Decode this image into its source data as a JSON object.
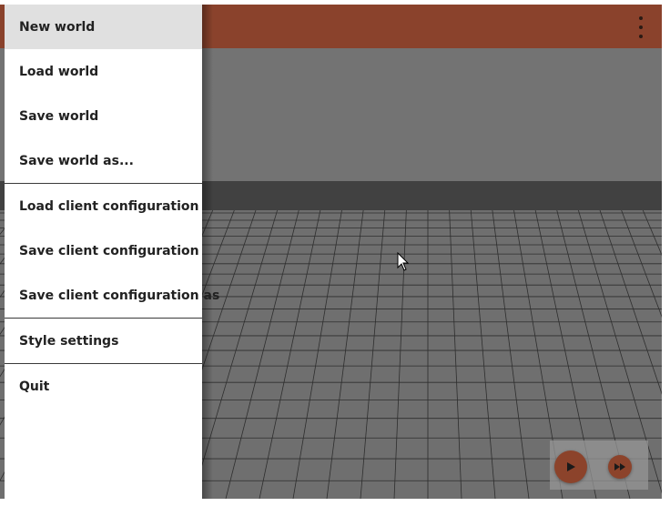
{
  "menu": {
    "groups": [
      {
        "items": [
          {
            "label": "New world",
            "active": true
          },
          {
            "label": "Load world"
          },
          {
            "label": "Save world"
          },
          {
            "label": "Save world as..."
          }
        ]
      },
      {
        "items": [
          {
            "label": "Load client configuration"
          },
          {
            "label": "Save client configuration"
          },
          {
            "label": "Save client configuration as"
          }
        ]
      },
      {
        "items": [
          {
            "label": "Style settings"
          }
        ]
      },
      {
        "items": [
          {
            "label": "Quit"
          }
        ]
      }
    ]
  },
  "toolbar": {
    "menu_icon": "more-vert-icon",
    "color": "#8a422c"
  },
  "simulation": {
    "play_icon": "play-icon",
    "fast_forward_icon": "fast-forward-icon",
    "button_color": "#8c432b"
  },
  "colors": {
    "accent": "#8a422c",
    "menu_active": "#e0e0e0"
  }
}
